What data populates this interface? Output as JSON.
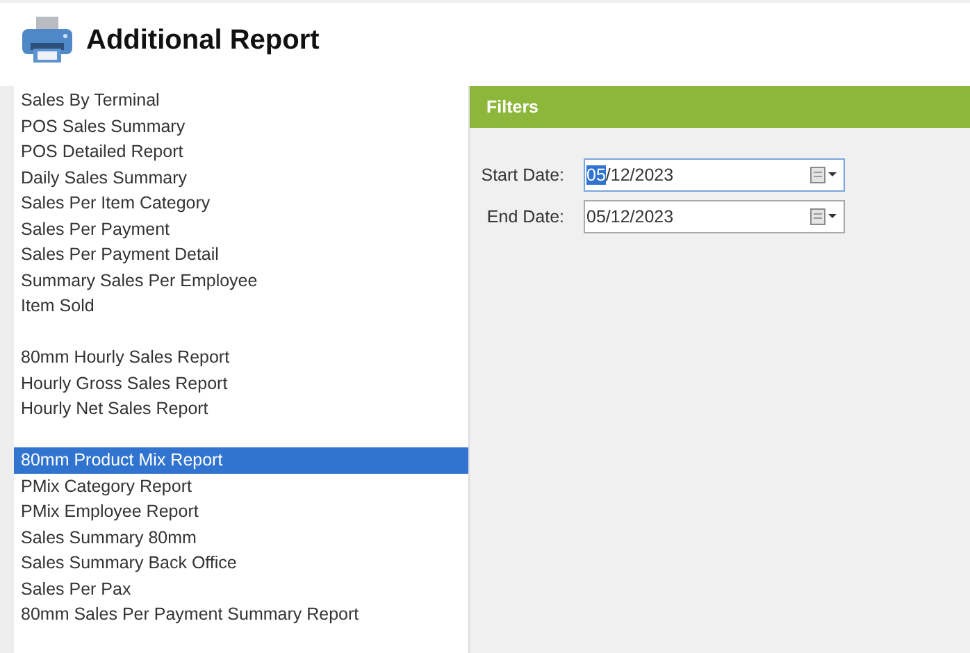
{
  "header": {
    "title": "Additional Report"
  },
  "report_groups": [
    {
      "items": [
        {
          "label": "Sales By Terminal",
          "selected": false
        },
        {
          "label": "POS Sales Summary",
          "selected": false
        },
        {
          "label": "POS Detailed Report",
          "selected": false
        },
        {
          "label": "Daily Sales Summary",
          "selected": false
        },
        {
          "label": "Sales Per Item Category",
          "selected": false
        },
        {
          "label": "Sales Per Payment",
          "selected": false
        },
        {
          "label": "Sales Per Payment Detail",
          "selected": false
        },
        {
          "label": "Summary Sales Per Employee",
          "selected": false
        },
        {
          "label": "Item Sold",
          "selected": false
        }
      ]
    },
    {
      "items": [
        {
          "label": "80mm Hourly Sales Report",
          "selected": false
        },
        {
          "label": "Hourly Gross Sales Report",
          "selected": false
        },
        {
          "label": "Hourly Net Sales Report",
          "selected": false
        }
      ]
    },
    {
      "items": [
        {
          "label": "80mm Product Mix Report",
          "selected": true
        },
        {
          "label": "PMix Category Report",
          "selected": false
        },
        {
          "label": "PMix Employee Report",
          "selected": false
        },
        {
          "label": "Sales Summary 80mm",
          "selected": false
        },
        {
          "label": "Sales Summary Back Office",
          "selected": false
        },
        {
          "label": "Sales Per Pax",
          "selected": false
        },
        {
          "label": "80mm Sales Per Payment Summary Report",
          "selected": false
        }
      ]
    }
  ],
  "filters": {
    "title": "Filters",
    "fields": [
      {
        "label": "Start Date:",
        "focused": true,
        "value_parts": [
          {
            "text": "05",
            "selected": true
          },
          {
            "text": "/12/2023",
            "selected": false
          }
        ]
      },
      {
        "label": "End Date:",
        "focused": false,
        "value_parts": [
          {
            "text": "05/12/2023",
            "selected": false
          }
        ]
      }
    ]
  }
}
